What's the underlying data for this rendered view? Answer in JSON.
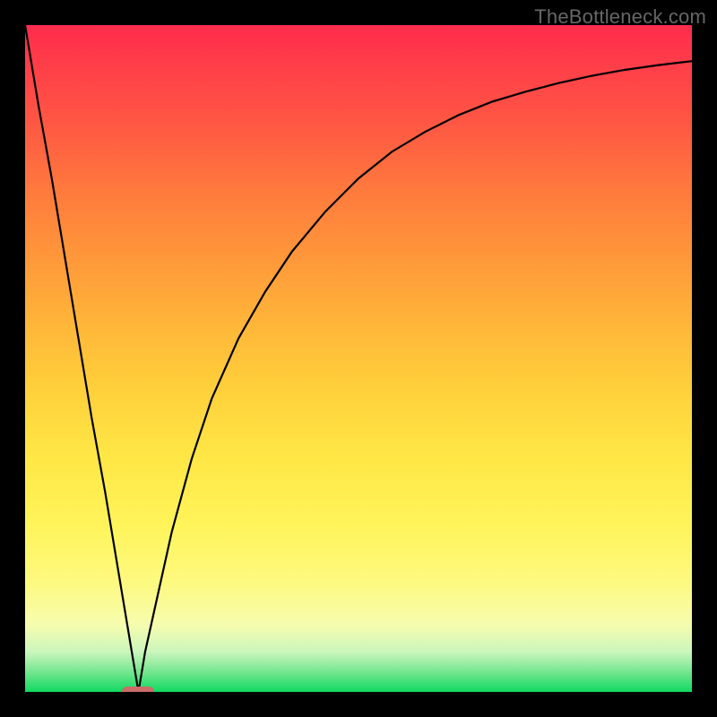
{
  "watermark": "TheBottleneck.com",
  "chart_data": {
    "type": "line",
    "title": "",
    "xlabel": "",
    "ylabel": "",
    "xlim": [
      0,
      100
    ],
    "ylim": [
      0,
      100
    ],
    "grid": false,
    "background_gradient": {
      "top": "#ff2b4c",
      "mid": "#ffe746",
      "bottom": "#10d960"
    },
    "series": [
      {
        "name": "bottleneck-curve",
        "x": [
          0,
          2,
          4,
          6,
          8,
          10,
          12,
          14,
          16,
          17,
          18,
          20,
          22,
          25,
          28,
          32,
          36,
          40,
          45,
          50,
          55,
          60,
          65,
          70,
          75,
          80,
          85,
          90,
          95,
          100
        ],
        "y": [
          100,
          88,
          77,
          65,
          53,
          41,
          30,
          18,
          6,
          0,
          6,
          15,
          24,
          35,
          44,
          53,
          60,
          66,
          72,
          77,
          81,
          84,
          86.5,
          88.5,
          90,
          91.3,
          92.4,
          93.3,
          94,
          94.6
        ]
      }
    ],
    "marker": {
      "x": 17,
      "y": 0,
      "color": "#cc6b68"
    }
  }
}
